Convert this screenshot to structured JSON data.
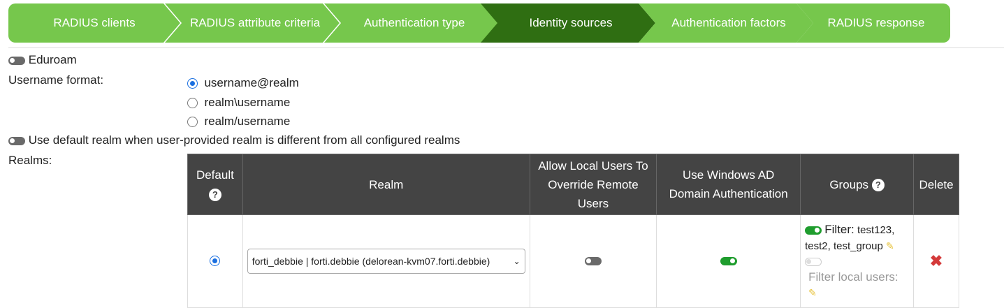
{
  "wizard": {
    "steps": [
      {
        "label": "RADIUS clients"
      },
      {
        "label": "RADIUS attribute criteria"
      },
      {
        "label": "Authentication type"
      },
      {
        "label": "Identity sources"
      },
      {
        "label": "Authentication factors"
      },
      {
        "label": "RADIUS response"
      }
    ],
    "active_index": 3
  },
  "eduroam": {
    "label": "Eduroam",
    "enabled": false
  },
  "username_format": {
    "label": "Username format:",
    "options": [
      "username@realm",
      "realm\\username",
      "realm/username"
    ],
    "selected": "username@realm"
  },
  "default_realm": {
    "label": "Use default realm when user-provided realm is different from all configured realms",
    "enabled": false
  },
  "realms": {
    "label": "Realms:",
    "headers": {
      "default": "Default",
      "realm": "Realm",
      "allow_local_1": "Allow Local Users To",
      "allow_local_2": "Override Remote",
      "allow_local_3": "Users",
      "use_ad_1": "Use Windows AD",
      "use_ad_2": "Domain Authentication",
      "groups": "Groups",
      "delete": "Delete"
    },
    "rows": [
      {
        "default": true,
        "realm": "forti_debbie | forti.debbie (delorean-kvm07.forti.debbie)",
        "allow_local_override": false,
        "use_windows_ad": true,
        "groups_filter_enabled": true,
        "groups_filter_label": "Filter:",
        "groups_filter_value_1": "test123,",
        "groups_filter_value_2": "test2, test_group",
        "filter_local_users_enabled": false,
        "filter_local_users_label": "Filter local users:"
      }
    ]
  },
  "colors": {
    "step_green": "#76c74c",
    "step_active": "#2f6e12",
    "header_bg": "#444444",
    "toggle_on": "#1f9d2e",
    "radio_blue": "#1a6fe0",
    "delete_red": "#d43a3a"
  },
  "icons": {
    "help": "question-circle-icon",
    "edit": "pencil-icon",
    "delete": "x-icon",
    "dropdown": "chevron-down-icon"
  }
}
